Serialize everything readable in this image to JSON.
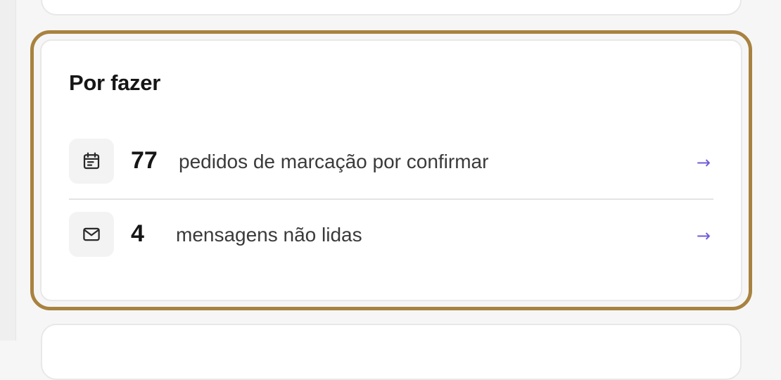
{
  "todo": {
    "title": "Por fazer",
    "items": [
      {
        "icon": "calendar-icon",
        "count": "77",
        "label": "pedidos de marcação por confirmar",
        "arrow": "→"
      },
      {
        "icon": "mail-icon",
        "count": "4",
        "label": "mensagens não lidas",
        "arrow": "→"
      }
    ]
  },
  "colors": {
    "focus_ring": "#a8823f",
    "arrow": "#6f5bd6",
    "text": "#161616"
  }
}
